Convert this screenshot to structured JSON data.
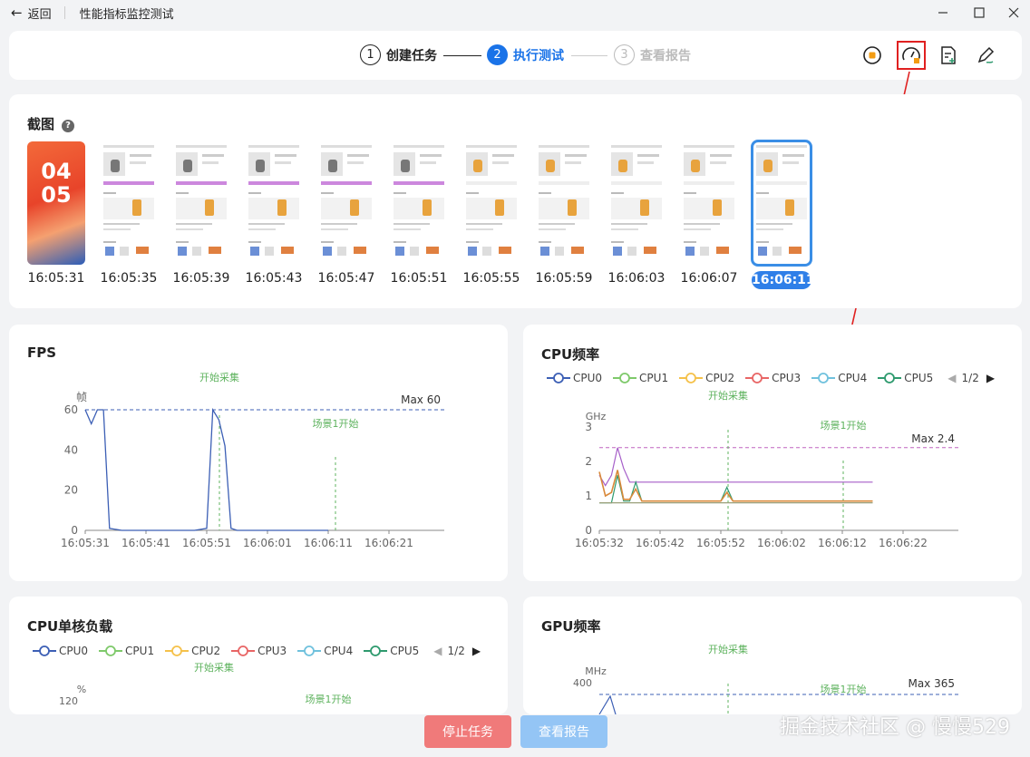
{
  "titlebar": {
    "back_label": "返回",
    "title": "性能指标监控测试"
  },
  "steps": [
    {
      "num": "1",
      "label": "创建任务",
      "state": "done"
    },
    {
      "num": "2",
      "label": "执行测试",
      "state": "active"
    },
    {
      "num": "3",
      "label": "查看报告",
      "state": "pending"
    }
  ],
  "screenshots": {
    "title": "截图",
    "help": "?",
    "times": [
      "16:05:31",
      "16:05:35",
      "16:05:39",
      "16:05:43",
      "16:05:47",
      "16:05:51",
      "16:05:55",
      "16:05:59",
      "16:06:03",
      "16:06:07",
      "16:06:11"
    ],
    "selected_index": 10,
    "lock_time": [
      "04",
      "05"
    ]
  },
  "fps_panel": {
    "title": "FPS",
    "annot_start": "开始采集",
    "annot_scene": "场景1开始",
    "max_label": "Max 60",
    "y_unit": "帧"
  },
  "cpu_freq_panel": {
    "title": "CPU频率",
    "legend": [
      "CPU0",
      "CPU1",
      "CPU2",
      "CPU3",
      "CPU4",
      "CPU5"
    ],
    "page": "1/2",
    "annot_start": "开始采集",
    "annot_scene": "场景1开始",
    "max_label": "Max 2.4",
    "y_unit": "GHz"
  },
  "cpu_load_panel": {
    "title": "CPU单核负载",
    "legend": [
      "CPU0",
      "CPU1",
      "CPU2",
      "CPU3",
      "CPU4",
      "CPU5"
    ],
    "page": "1/2",
    "annot_start": "开始采集",
    "annot_scene": "场景1开始",
    "y_unit": "%",
    "y_top": "120"
  },
  "gpu_panel": {
    "title": "GPU频率",
    "annot_start": "开始采集",
    "annot_scene": "场景1开始",
    "max_label": "Max 365",
    "y_unit": "MHz",
    "y_top": "400"
  },
  "buttons": {
    "stop": "停止任务",
    "report": "查看报告"
  },
  "watermark": "掘金技术社区 @ 慢慢529",
  "colors": {
    "accent": "#1a73e8",
    "stop": "#f07a7a",
    "report": "#94c5f5",
    "series": [
      "#3c5fb5",
      "#7ec96a",
      "#f5c14a",
      "#e86565",
      "#6fc1dd",
      "#2e9a6e"
    ]
  },
  "chart_data": [
    {
      "type": "line",
      "title": "FPS",
      "ylabel": "帧",
      "x": [
        "16:05:31",
        "16:05:41",
        "16:05:51",
        "16:06:01",
        "16:06:11",
        "16:06:21"
      ],
      "yticks": [
        0,
        20,
        40,
        60
      ],
      "ylim": [
        0,
        60
      ],
      "series": [
        {
          "values": [
            [
              0,
              60
            ],
            [
              1,
              53
            ],
            [
              2,
              60
            ],
            [
              3,
              60
            ],
            [
              4,
              1
            ],
            [
              6,
              0
            ],
            [
              8,
              0
            ],
            [
              10,
              0
            ],
            [
              12,
              0
            ],
            [
              14,
              0
            ],
            [
              16,
              0
            ],
            [
              18,
              0
            ],
            [
              20,
              1
            ],
            [
              21,
              60
            ],
            [
              22,
              55
            ],
            [
              23,
              42
            ],
            [
              24,
              1
            ],
            [
              25,
              0
            ],
            [
              30,
              0
            ],
            [
              40,
              0
            ]
          ]
        }
      ],
      "max_line": 60
    },
    {
      "type": "line",
      "title": "CPU频率",
      "ylabel": "GHz",
      "x": [
        "16:05:32",
        "16:05:42",
        "16:05:52",
        "16:06:02",
        "16:06:12",
        "16:06:22"
      ],
      "yticks": [
        0,
        1,
        2,
        3
      ],
      "ylim": [
        0,
        3
      ],
      "max_line": 2.4
    }
  ]
}
